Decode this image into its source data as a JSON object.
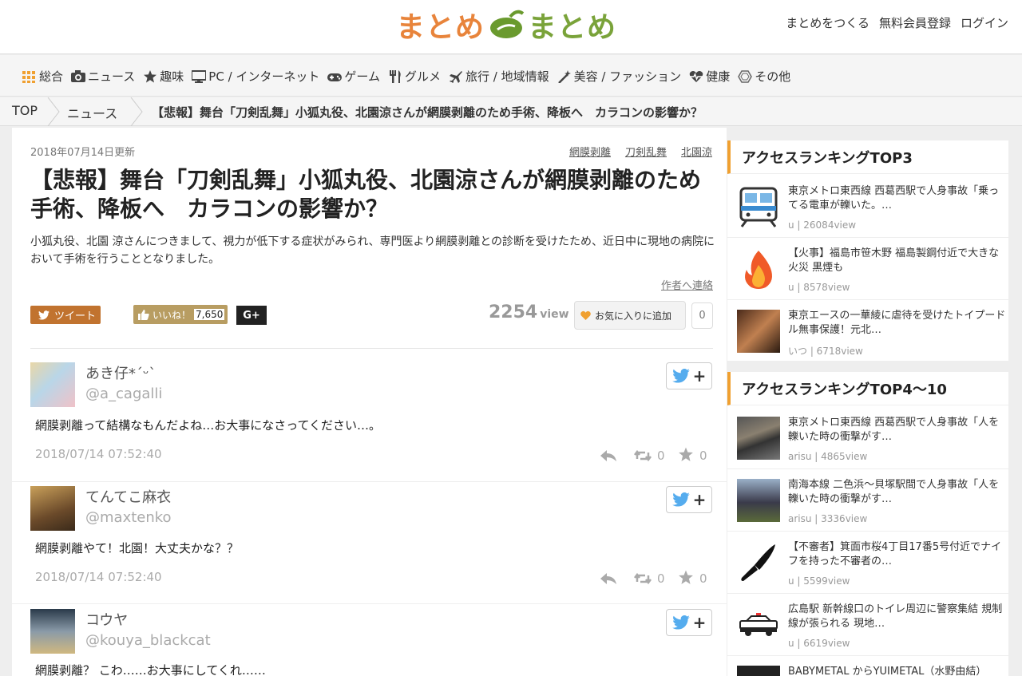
{
  "header": {
    "logo_left": "まとめ",
    "logo_right": "まとめ",
    "nav": [
      "まとめをつくる",
      "無料会員登録",
      "ログイン"
    ]
  },
  "categories": [
    {
      "label": "総合",
      "icon": "grid-icon"
    },
    {
      "label": "ニュース",
      "icon": "camera-icon"
    },
    {
      "label": "趣味",
      "icon": "star-icon"
    },
    {
      "label": "PC / インターネット",
      "icon": "monitor-icon"
    },
    {
      "label": "ゲーム",
      "icon": "gamepad-icon"
    },
    {
      "label": "グルメ",
      "icon": "fork-knife-icon"
    },
    {
      "label": "旅行 / 地域情報",
      "icon": "plane-icon"
    },
    {
      "label": "美容 / ファッション",
      "icon": "wand-icon"
    },
    {
      "label": "健康",
      "icon": "heartbeat-icon"
    },
    {
      "label": "その他",
      "icon": "hexagon-icon"
    }
  ],
  "breadcrumb": {
    "top": "TOP",
    "category": "ニュース",
    "current": "【悲報】舞台「刀剣乱舞」小狐丸役、北園涼さんが網膜剥離のため手術、降板へ　カラコンの影響か？"
  },
  "article": {
    "date": "2018年07月14日更新",
    "tags": [
      "網膜剥離",
      "刀剣乱舞",
      "北園涼"
    ],
    "title": "【悲報】舞台「刀剣乱舞」小狐丸役、北園涼さんが網膜剥離のため手術、降板へ　カラコンの影響か？",
    "description": "小狐丸役、北園 涼さんにつきまして、視力が低下する症状がみられ、専門医より網膜剥離との診断を受けたため、近日中に現地の病院において手術を行うこととなりました。",
    "contact": "作者へ連絡",
    "tweet_label": "ツイート",
    "like_label": "いいね！",
    "like_count": "7,650",
    "gplus_label": "G+",
    "views": "2254",
    "views_unit": "view",
    "fav_label": "お気に入りに追加",
    "fav_count": "0"
  },
  "comments": [
    {
      "name": "あき仔*´ᵕ`",
      "handle": "@a_cagalli",
      "text": "網膜剥離って結構なもんだよね…お大事になさってください…。",
      "time": "2018/07/14 07:52:40",
      "rt": "0",
      "fav": "0"
    },
    {
      "name": "てんてこ麻衣",
      "handle": "@maxtenko",
      "text": "網膜剥離やて！北園！大丈夫かな？？",
      "time": "2018/07/14 07:52:40",
      "rt": "0",
      "fav": "0"
    },
    {
      "name": "コウヤ",
      "handle": "@kouya_blackcat",
      "text": "網膜剥離？ こわ……お大事にしてくれ……"
    }
  ],
  "ranking1": {
    "title": "アクセスランキングTOP3",
    "items": [
      {
        "title": "東京メトロ東西線 西葛西駅で人身事故「乗ってる電車が轢いた。…",
        "meta": "u | 26084view"
      },
      {
        "title": "【火事】福島市笹木野 福島製鋼付近で大きな火災 黒煙も",
        "meta": "u | 8578view"
      },
      {
        "title": "東京エースの一華綾に虐待を受けたトイプードル無事保護！元北…",
        "meta": "いつ | 6718view"
      }
    ]
  },
  "ranking2": {
    "title": "アクセスランキングTOP4〜10",
    "items": [
      {
        "title": "東京メトロ東西線 西葛西駅で人身事故「人を轢いた時の衝撃がす…",
        "meta": "arisu | 4865view"
      },
      {
        "title": "南海本線 二色浜〜貝塚駅間で人身事故「人を轢いた時の衝撃がす…",
        "meta": "arisu | 3336view"
      },
      {
        "title": "【不審者】箕面市桜4丁目17番5号付近でナイフを持った不審者の…",
        "meta": "u | 5599view"
      },
      {
        "title": "広島駅 新幹線口のトイレ周辺に警察集結 規制線が張られる 現地…",
        "meta": "u | 6619view"
      },
      {
        "title": "BABYMETAL からYUIMETAL（水野由結）"
      }
    ]
  }
}
